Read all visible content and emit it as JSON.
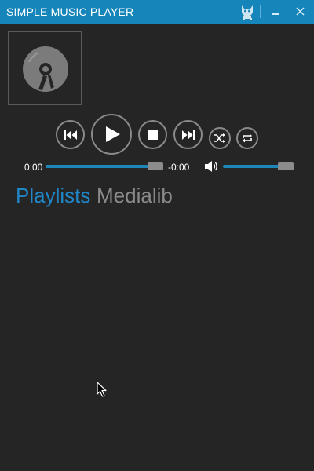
{
  "window": {
    "title": "SIMPLE MUSIC PLAYER",
    "buttons": [
      "minimize-icon",
      "close-icon"
    ]
  },
  "colors": {
    "titlebar": "#1585ba",
    "background": "#252525",
    "accent": "#1f86c8",
    "inactive": "#8a8a8a"
  },
  "icons": {
    "album": "disc-icon",
    "prev": "skip-previous-icon",
    "play": "play-icon",
    "stop": "stop-icon",
    "next": "skip-next-icon",
    "shuffle": "shuffle-icon",
    "repeat": "repeat-icon",
    "volume": "speaker-icon"
  },
  "playback": {
    "elapsed": "0:00",
    "remaining": "-0:00",
    "progress_fraction": 1.0,
    "volume_fraction": 1.0
  },
  "tabs": [
    {
      "label": "Playlists",
      "active": true
    },
    {
      "label": "Medialib",
      "active": false
    }
  ]
}
